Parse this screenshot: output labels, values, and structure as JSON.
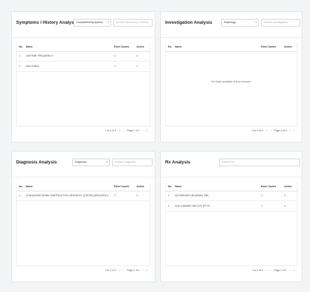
{
  "symptoms": {
    "title": "Symptoms / History Analysis",
    "select_value": "Complaints/Symptoms",
    "search_placeholder": "Search Symptoms / History",
    "columns": {
      "no": "No.",
      "name": "Name",
      "count": "Exist Counts",
      "action": "Action"
    },
    "rows": [
      {
        "no": "1",
        "name": "DAYTIME FREQUENCY",
        "count": "1",
        "action": "1"
      },
      {
        "no": "2",
        "name": "NOCTURIA",
        "count": "1",
        "action": "1"
      }
    ],
    "pagination": {
      "range": "1 to 2 of 2",
      "page": "Page 1 of 1"
    }
  },
  "investigation": {
    "title": "Investigation Analysis",
    "select_value": "Radiology",
    "search_placeholder": "Search Investigation",
    "columns": {
      "no": "No.",
      "name": "Name",
      "count": "Exist Counts",
      "action": "Action"
    },
    "empty_text": "No Data available at this moment.",
    "pagination": {
      "range": "0 to 0 of 0",
      "page": "Page 0 of 0"
    }
  },
  "diagnosis": {
    "title": "Diagnosis Analysis",
    "select_value": "Diagnosis",
    "search_placeholder": "Search Diagnosis",
    "columns": {
      "no": "No.",
      "name": "Name",
      "count": "Exist Counts",
      "action": "Action"
    },
    "rows": [
      {
        "no": "1",
        "name": "UI BLADDER WORK OBSTRUCTIVE UROPATHY (CROSS) (RELATED IN SITU) WITH IN METTAL...",
        "count": "1",
        "action": "1"
      }
    ],
    "pagination": {
      "range": "1 to 1 of 1",
      "page": "Page 1 of 1"
    }
  },
  "rx": {
    "title": "Rx Analysis",
    "search_placeholder": "Search Rx",
    "columns": {
      "no": "No.",
      "name": "Name",
      "count": "Exist Counts",
      "action": "Action"
    },
    "rows": [
      {
        "no": "1",
        "name": "AZITHROMYCIN 500MG TAB",
        "count": "1",
        "action": "1"
      },
      {
        "no": "2",
        "name": "DOLO 650MG TAB 10'S (PT 57",
        "count": "1",
        "action": "1"
      }
    ],
    "pagination": {
      "range": "1 to 2 of 2",
      "page": "Page 1 of 1"
    }
  },
  "icons": {
    "caret": "chevron-down-icon",
    "first": "«",
    "prev": "‹",
    "next": "›",
    "last": "»",
    "nav_first": "first-page-icon",
    "nav_prev": "prev-page-icon",
    "nav_next": "next-page-icon",
    "nav_last": "last-page-icon"
  }
}
